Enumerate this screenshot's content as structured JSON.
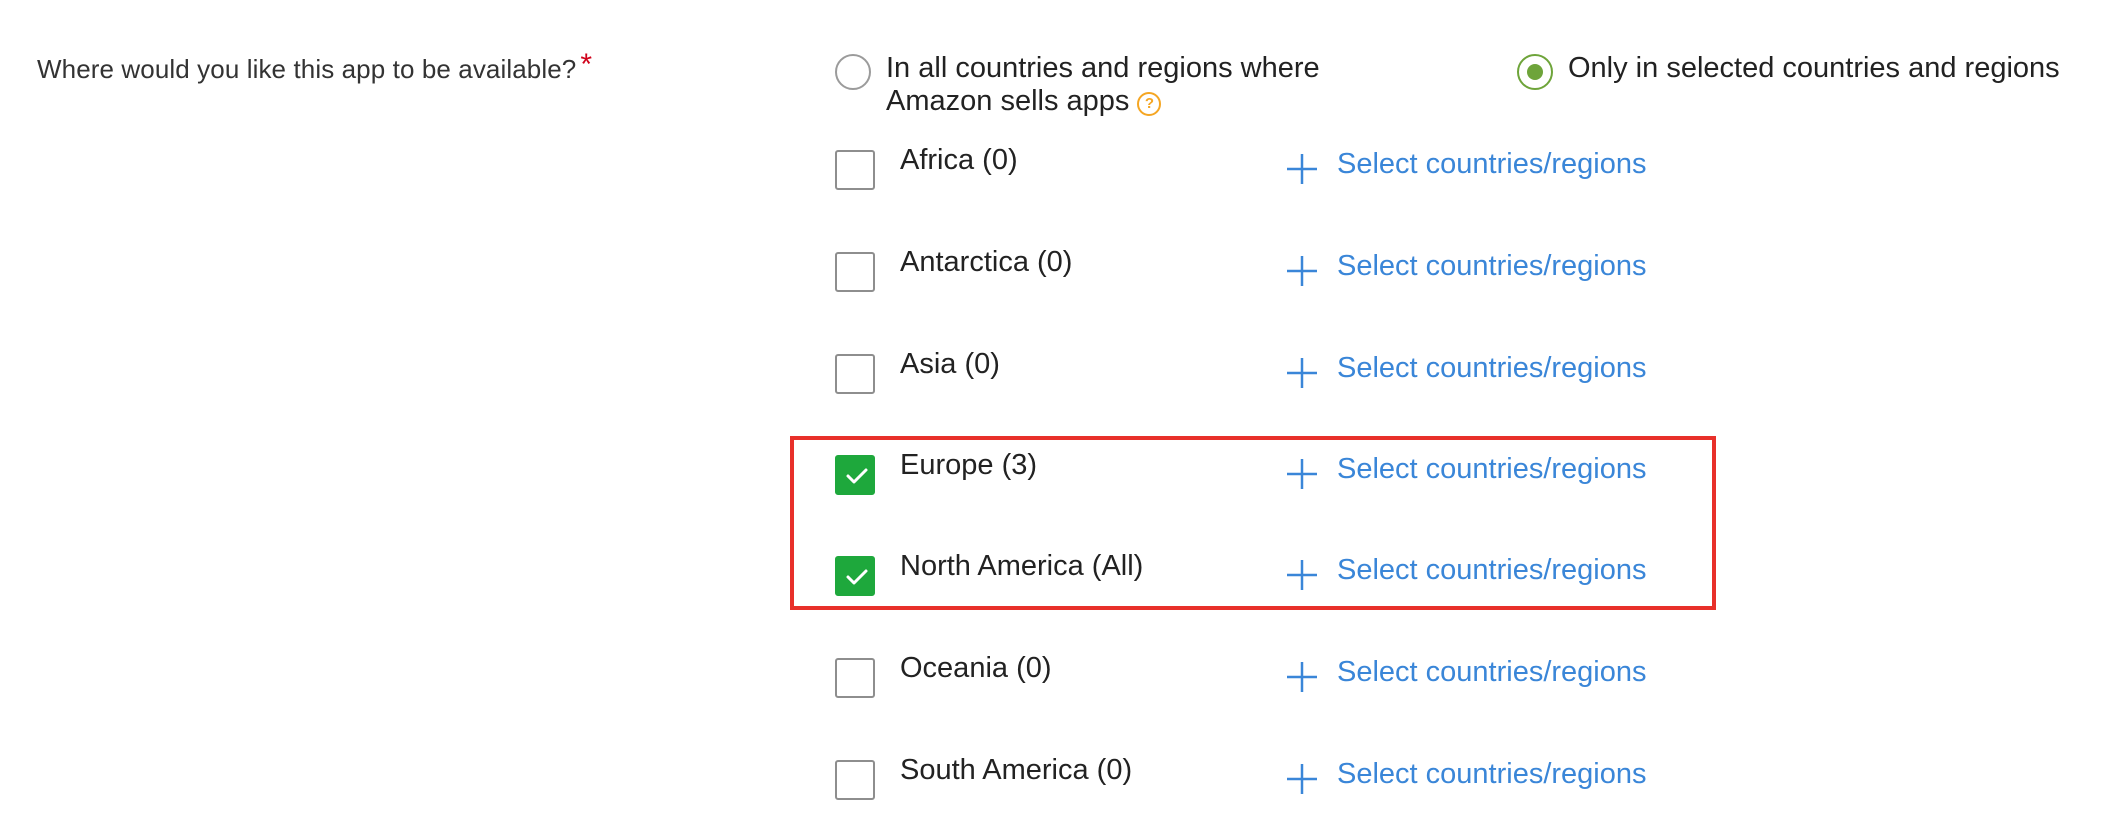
{
  "question": {
    "label": "Where would you like this app to be available?",
    "required_marker": "*"
  },
  "availability_options": [
    {
      "line1": "In all countries and regions where",
      "line2": "Amazon sells apps",
      "selected": false,
      "help_icon": "question-circle-icon"
    },
    {
      "line1": "Only in selected countries and regions",
      "selected": true
    }
  ],
  "regions": [
    {
      "label": "Africa (0)",
      "checked": false,
      "link_label": "Select countries/regions"
    },
    {
      "label": "Antarctica (0)",
      "checked": false,
      "link_label": "Select countries/regions"
    },
    {
      "label": "Asia (0)",
      "checked": false,
      "link_label": "Select countries/regions"
    },
    {
      "label": "Europe (3)",
      "checked": true,
      "link_label": "Select countries/regions"
    },
    {
      "label": "North America (All)",
      "checked": true,
      "link_label": "Select countries/regions"
    },
    {
      "label": "Oceania (0)",
      "checked": false,
      "link_label": "Select countries/regions"
    },
    {
      "label": "South America (0)",
      "checked": false,
      "link_label": "Select countries/regions"
    }
  ],
  "colors": {
    "accent_green": "#1ea83c",
    "radio_green": "#6ea43a",
    "link_blue": "#3a86d8",
    "highlight_red": "#e8302a",
    "required_red": "#d0021b",
    "help_orange": "#f5a623"
  },
  "icons": {
    "check": "check-icon",
    "plus": "plus-icon",
    "help": "question-circle-icon"
  }
}
